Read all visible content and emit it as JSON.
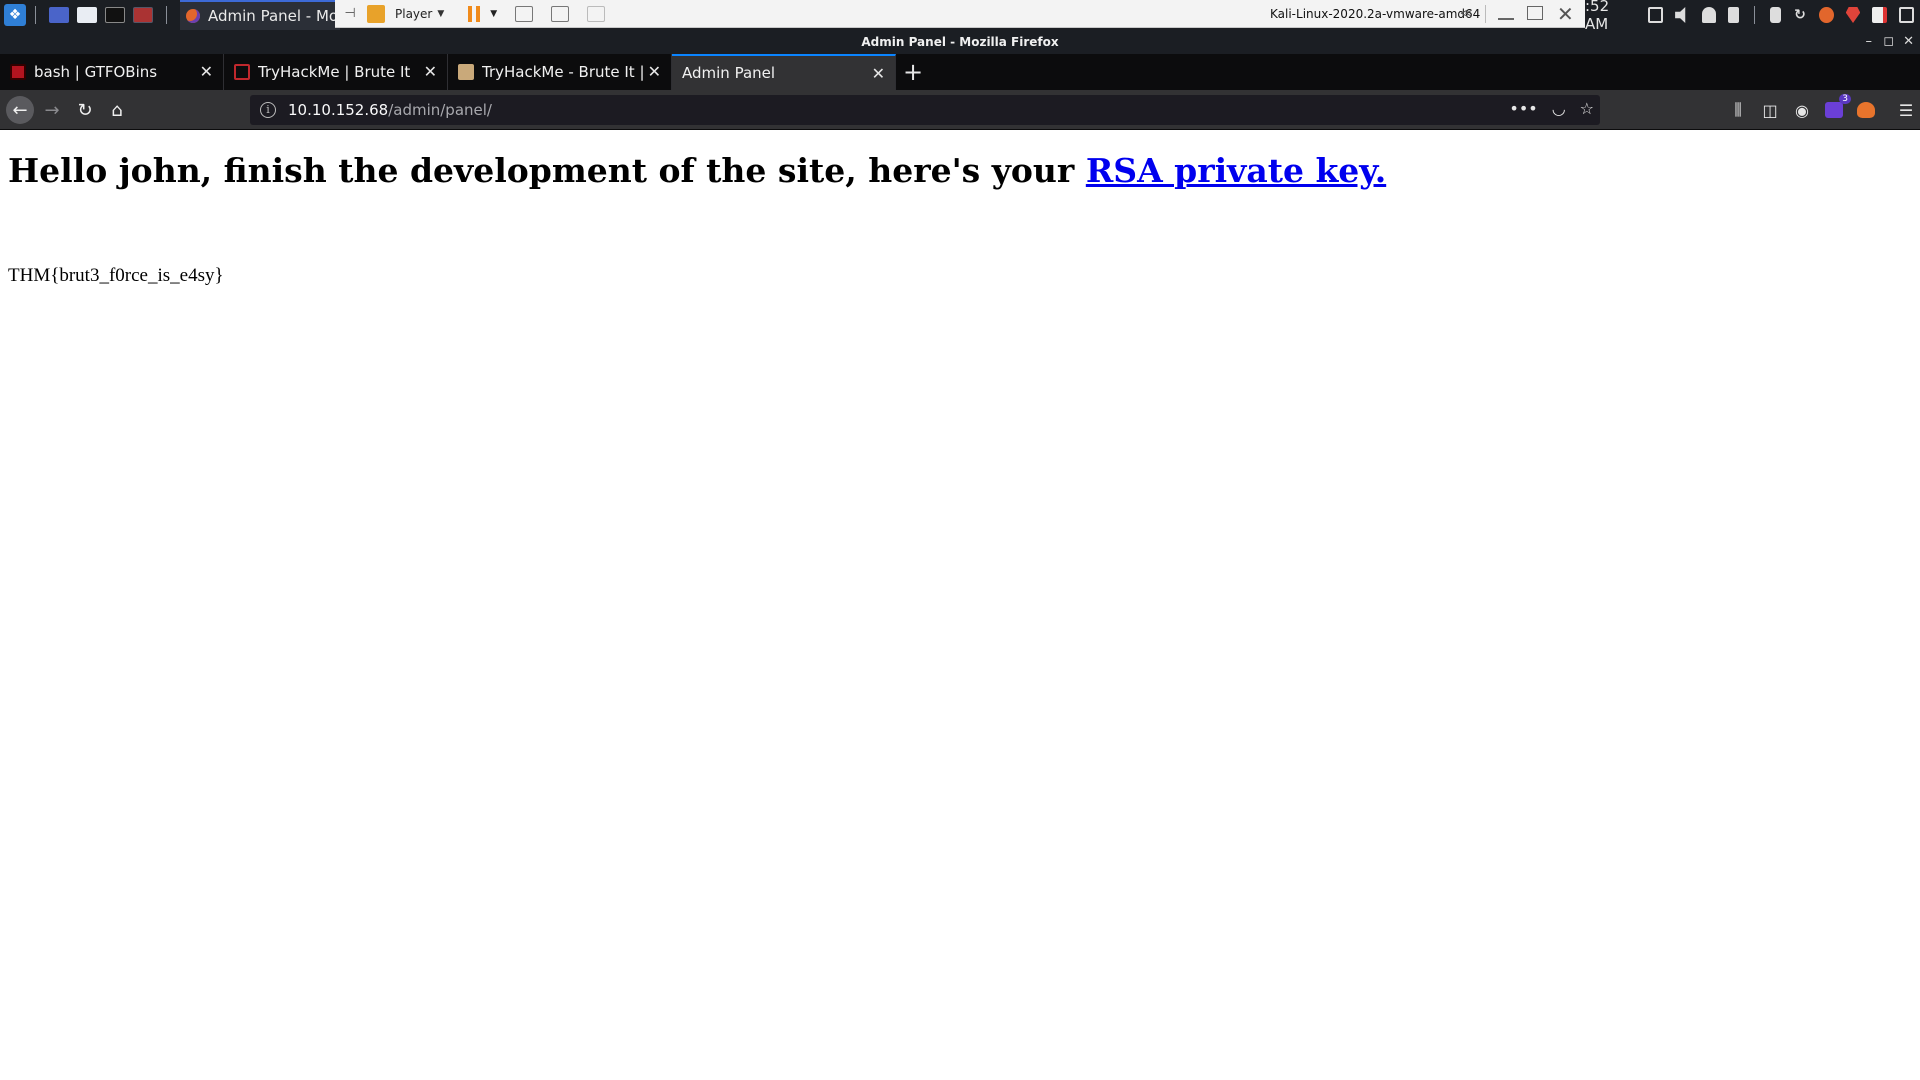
{
  "taskbar": {
    "active_window": "Admin Panel - Mozi",
    "clock": ":52 AM"
  },
  "vmware": {
    "player_label": "Player",
    "host_name": "Kali-Linux-2020.2a-vmware-amd64"
  },
  "window": {
    "title": "Admin Panel - Mozilla Firefox"
  },
  "tabs": [
    {
      "label": "bash | GTFOBins",
      "active": false
    },
    {
      "label": "TryHackMe | Brute It",
      "active": false
    },
    {
      "label": "TryHackMe - Brute It | qt",
      "active": false
    },
    {
      "label": "Admin Panel",
      "active": true
    }
  ],
  "urlbar": {
    "host": "10.10.152.68",
    "path": "/admin/panel/"
  },
  "extensions": {
    "badge_count": "3"
  },
  "page": {
    "heading_text": "Hello john, finish the development of the site, here's your ",
    "heading_link": "RSA private key.",
    "flag": "THM{brut3_f0rce_is_e4sy}"
  },
  "colors": {
    "link": "#0000ee",
    "active_tab_accent": "#0a84ff",
    "tab_strip": "#0c0c0d",
    "toolbar": "#323234"
  }
}
